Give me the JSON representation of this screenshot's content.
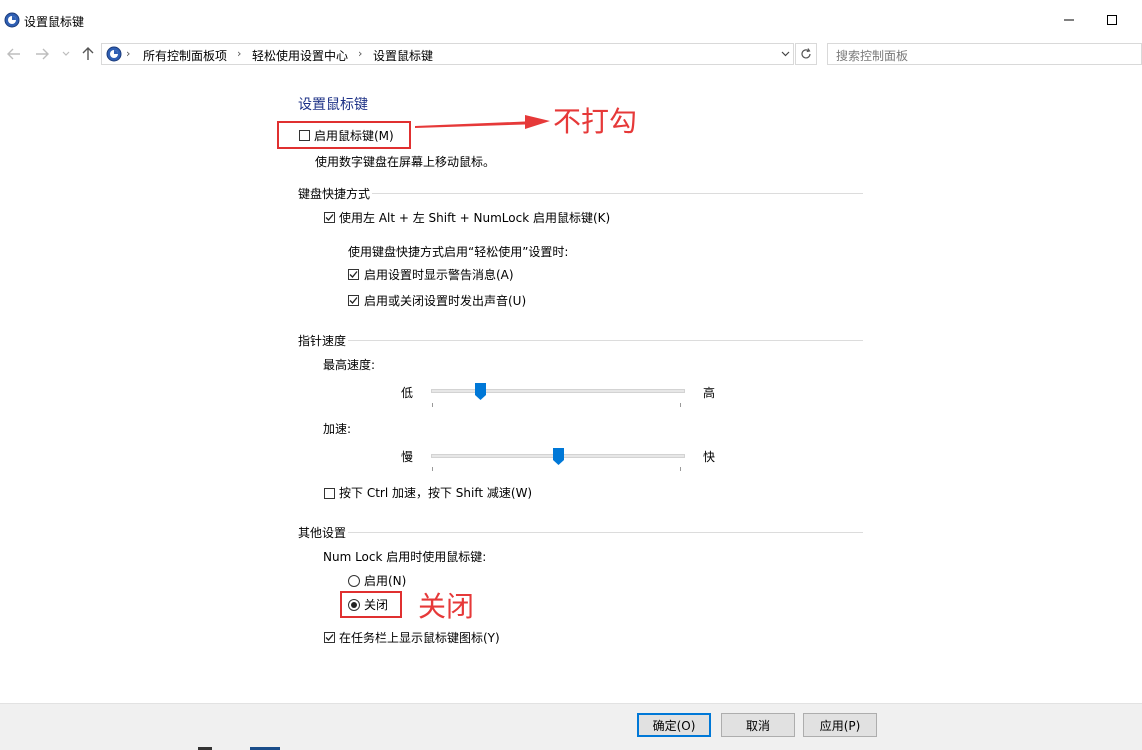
{
  "window": {
    "title": "设置鼠标键",
    "minimize_icon": "minimize-icon",
    "maximize_icon": "maximize-icon"
  },
  "nav": {
    "breadcrumbs": [
      "所有控制面板项",
      "轻松使用设置中心",
      "设置鼠标键"
    ],
    "search_placeholder": "搜索控制面板"
  },
  "content": {
    "title": "设置鼠标键",
    "enable_mousekeys": {
      "label": "启用鼠标键(M)",
      "checked": false
    },
    "enable_desc": "使用数字键盘在屏幕上移动鼠标。",
    "keyboard_shortcut": {
      "heading": "键盘快捷方式",
      "shortcut_option": {
        "label": "使用左 Alt + 左 Shift + NumLock 启用鼠标键(K)",
        "checked": true
      },
      "sub_heading": "使用键盘快捷方式启用“轻松使用”设置时:",
      "warning_option": {
        "label": "启用设置时显示警告消息(A)",
        "checked": true
      },
      "sound_option": {
        "label": "启用或关闭设置时发出声音(U)",
        "checked": true
      }
    },
    "pointer_speed": {
      "heading": "指针速度",
      "top_speed": {
        "label": "最高速度:",
        "low": "低",
        "high": "高",
        "value_fraction": 0.18
      },
      "acceleration": {
        "label": "加速:",
        "low": "慢",
        "high": "快",
        "value_fraction": 0.5
      },
      "ctrl_shift_option": {
        "label": "按下 Ctrl 加速，按下 Shift 减速(W)",
        "checked": false
      }
    },
    "other": {
      "heading": "其他设置",
      "numlock_label": "Num Lock 启用时使用鼠标键:",
      "radio_on": {
        "label": "启用(N)",
        "selected": false
      },
      "radio_off": {
        "label": "关闭",
        "selected": true
      },
      "taskbar_option": {
        "label": "在任务栏上显示鼠标键图标(Y)",
        "checked": true
      }
    }
  },
  "annotations": {
    "no_check": "不打勾",
    "close": "关闭",
    "color": "#e03030"
  },
  "footer": {
    "ok": "确定(O)",
    "cancel": "取消",
    "apply": "应用(P)"
  },
  "colors": {
    "title_blue": "#1e3287",
    "slider_blue": "#0078d7"
  }
}
